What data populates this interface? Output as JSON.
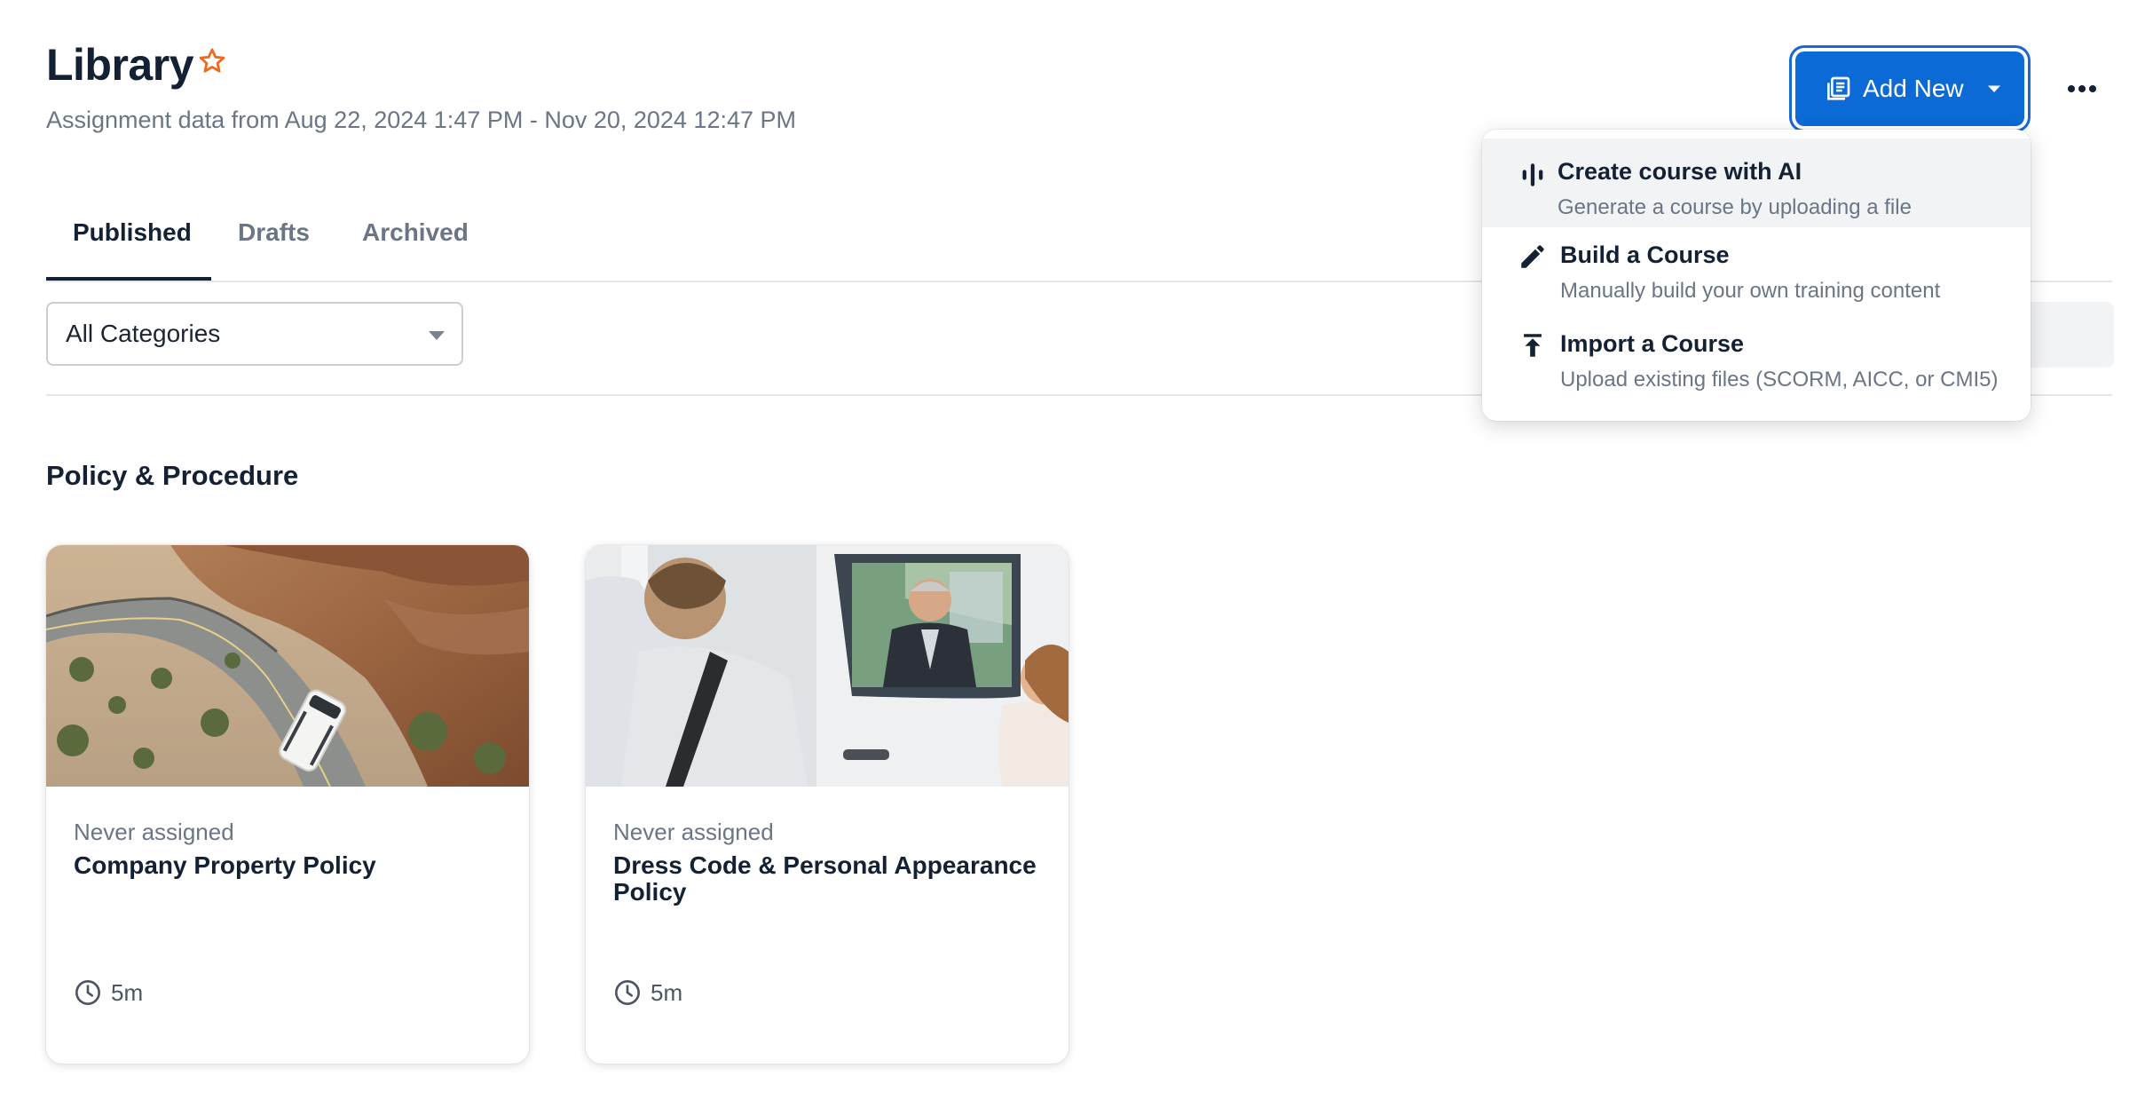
{
  "header": {
    "title": "Library",
    "subtitle": "Assignment data from Aug 22, 2024 1:47 PM - Nov 20, 2024 12:47 PM",
    "star_icon": "star-outline-icon",
    "add_new_label": "Add New",
    "more_icon": "more-horizontal-icon"
  },
  "tabs": [
    {
      "label": "Published",
      "active": true
    },
    {
      "label": "Drafts",
      "active": false
    },
    {
      "label": "Archived",
      "active": false
    }
  ],
  "filters": {
    "category_value": "All Categories"
  },
  "section": {
    "title": "Policy & Procedure"
  },
  "cards": [
    {
      "status": "Never assigned",
      "title": "Company Property Policy",
      "duration": "5m",
      "image": "bus-on-canyon-road"
    },
    {
      "status": "Never assigned",
      "title": "Dress Code & Personal Appearance Policy",
      "duration": "5m",
      "image": "driver-in-van-greeting-passengers"
    }
  ],
  "dropdown": {
    "items": [
      {
        "label": "Create course with AI",
        "description": "Generate a course by uploading a file",
        "icon": "ai-waveform-icon"
      },
      {
        "label": "Build a Course",
        "description": "Manually build your own training content",
        "icon": "pencil-icon"
      },
      {
        "label": "Import a Course",
        "description": "Upload existing files (SCORM, AICC, or CMI5)",
        "icon": "upload-icon"
      }
    ]
  },
  "colors": {
    "primary": "#0b6ad6",
    "star": "#f06a1a",
    "text_dark": "#142033",
    "text_muted": "#6a7585"
  }
}
